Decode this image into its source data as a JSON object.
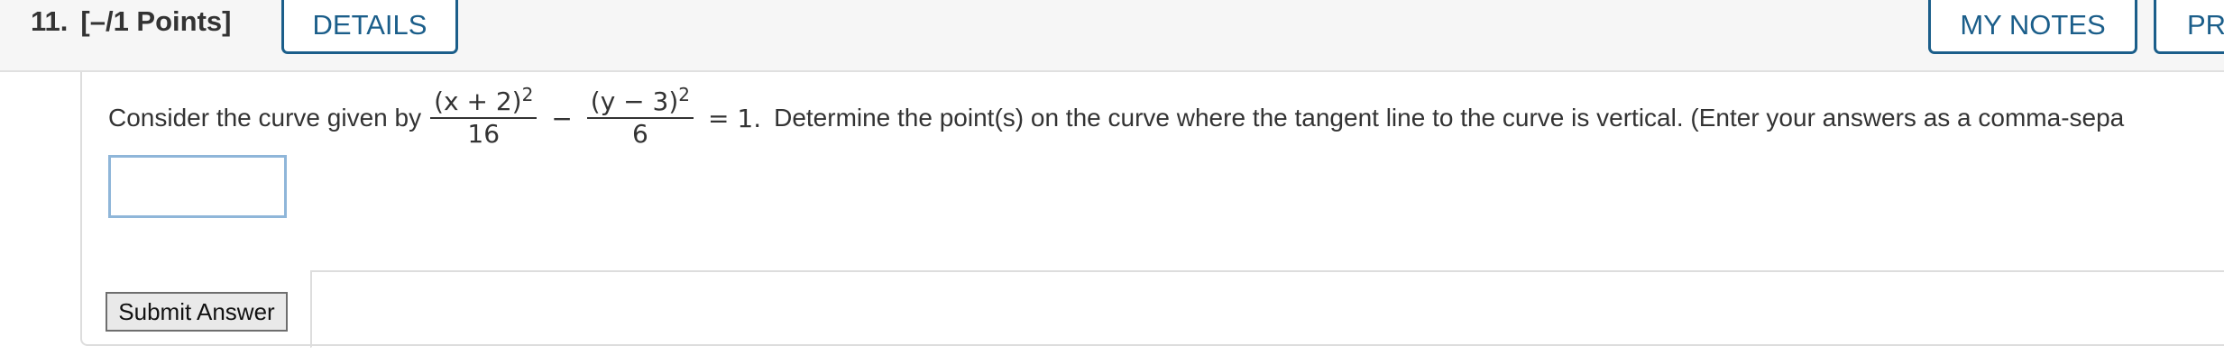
{
  "question": {
    "number": "11.",
    "points": "[–/1 Points]",
    "prefix": "Consider the curve given by",
    "frac1": {
      "num_base": "(x + 2)",
      "num_exp": "2",
      "den": "16"
    },
    "operator": "−",
    "frac2": {
      "num_base": "(y − 3)",
      "num_exp": "2",
      "den": "6"
    },
    "equals": "= 1.",
    "text_rest": "Determine the point(s) on the curve where the tangent line to the curve is vertical. (Enter your answers as a comma-sepa"
  },
  "header_buttons": {
    "details": "DETAILS",
    "my_notes": "MY NOTES",
    "practice": "PRA"
  },
  "answer_input": {
    "value": "",
    "placeholder": ""
  },
  "submit": {
    "label": "Submit Answer"
  },
  "colors": {
    "accent": "#1b5e8a",
    "input_border": "#8fb6d9",
    "header_bg": "#f6f6f6"
  }
}
